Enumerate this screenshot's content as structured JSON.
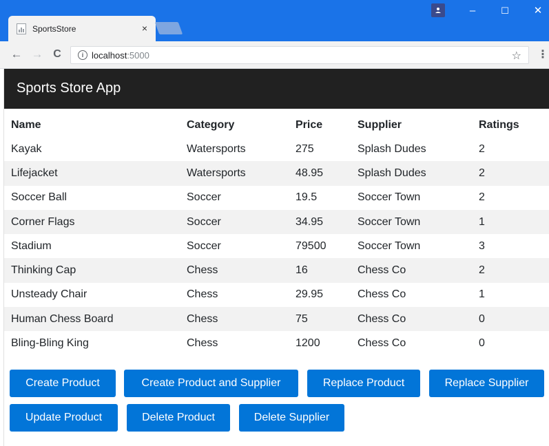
{
  "browser": {
    "tab_title": "SportsStore",
    "tab_close": "×",
    "url_host": "localhost",
    "url_port": ":5000",
    "win_minimize": "–",
    "win_maximize": "☐",
    "win_close": "✕",
    "back": "←",
    "forward": "→",
    "reload": "C",
    "star": "☆",
    "menu": "⋮",
    "info": "i"
  },
  "app": {
    "brand": "Sports Store App"
  },
  "table": {
    "headers": [
      "Name",
      "Category",
      "Price",
      "Supplier",
      "Ratings"
    ],
    "rows": [
      [
        "Kayak",
        "Watersports",
        "275",
        "Splash Dudes",
        "2"
      ],
      [
        "Lifejacket",
        "Watersports",
        "48.95",
        "Splash Dudes",
        "2"
      ],
      [
        "Soccer Ball",
        "Soccer",
        "19.5",
        "Soccer Town",
        "2"
      ],
      [
        "Corner Flags",
        "Soccer",
        "34.95",
        "Soccer Town",
        "1"
      ],
      [
        "Stadium",
        "Soccer",
        "79500",
        "Soccer Town",
        "3"
      ],
      [
        "Thinking Cap",
        "Chess",
        "16",
        "Chess Co",
        "2"
      ],
      [
        "Unsteady Chair",
        "Chess",
        "29.95",
        "Chess Co",
        "1"
      ],
      [
        "Human Chess Board",
        "Chess",
        "75",
        "Chess Co",
        "0"
      ],
      [
        "Bling-Bling King",
        "Chess",
        "1200",
        "Chess Co",
        "0"
      ]
    ]
  },
  "buttons": {
    "create_product": "Create Product",
    "create_product_supplier": "Create Product and Supplier",
    "replace_product": "Replace Product",
    "replace_supplier": "Replace Supplier",
    "update_product": "Update Product",
    "delete_product": "Delete Product",
    "delete_supplier": "Delete Supplier"
  },
  "colors": {
    "chrome_blue": "#1a73e8",
    "navbar": "#212121",
    "primary_button": "#0275d8",
    "stripe": "#f2f2f2"
  }
}
